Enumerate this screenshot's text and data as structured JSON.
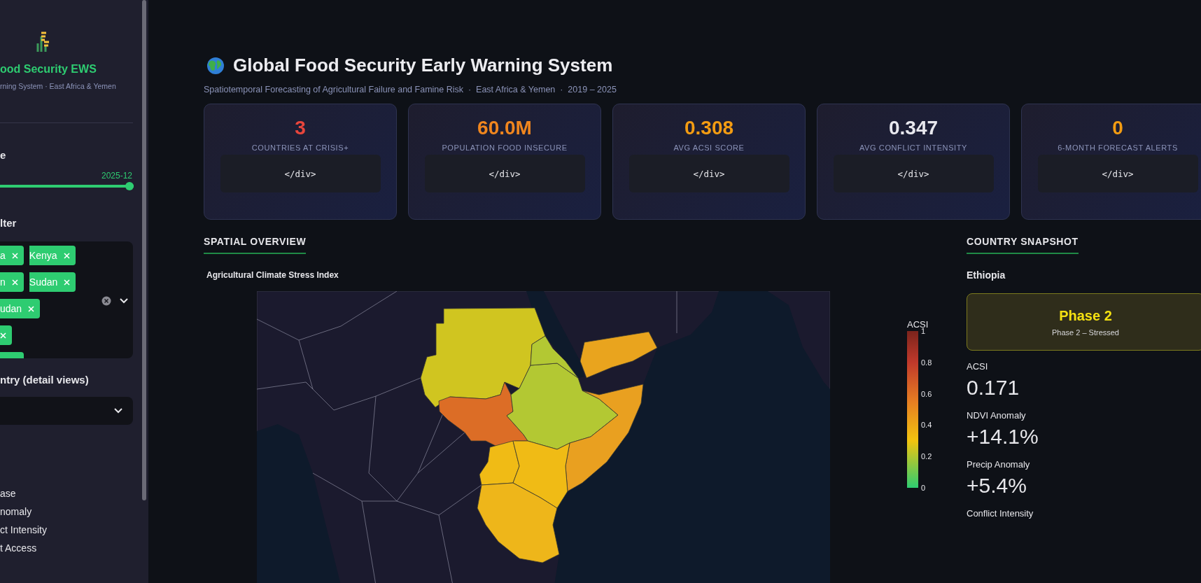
{
  "sidebar": {
    "title": "ood Security EWS",
    "subtitle": "rning System · East Africa & Yemen",
    "date_slider": {
      "label": "e",
      "value": "2025-12",
      "level": 1
    },
    "country_filter": {
      "label": "lter",
      "tag_rows": [
        {
          "tags": [
            {
              "kind": "chip",
              "label": "a"
            },
            {
              "kind": "chip",
              "label": "Kenya"
            }
          ]
        },
        {
          "tags": [
            {
              "kind": "chip",
              "label": "n"
            },
            {
              "kind": "chip",
              "label": "Sudan"
            }
          ]
        },
        {
          "tags": [
            {
              "kind": "chip",
              "label": "udan"
            }
          ]
        },
        {
          "tags": [
            {
              "kind": "icon"
            }
          ]
        },
        {
          "tags": [
            {
              "kind": "clipped"
            }
          ]
        }
      ]
    },
    "focus_country": {
      "label": "ntry (detail views)"
    },
    "map_layer": {
      "options": [
        {
          "label": "ase"
        },
        {
          "label": "nomaly"
        },
        {
          "label": "ct Intensity"
        },
        {
          "label": "t Access"
        }
      ]
    }
  },
  "header": {
    "title": "Global Food Security Early Warning System",
    "subtitle": "Spatiotemporal Forecasting of Agricultural Failure and Famine Risk  ·  East Africa & Yemen  ·  2019 – 2025"
  },
  "kpi_cards": [
    {
      "value": "3",
      "label": "COUNTRIES AT CRISIS+",
      "color": "#e8453c",
      "note": "</div>"
    },
    {
      "value": "60.0M",
      "label": "POPULATION FOOD INSECURE",
      "color": "#f0861e",
      "note": "</div>"
    },
    {
      "value": "0.308",
      "label": "AVG ACSI SCORE",
      "color": "#f39c12",
      "note": "</div>"
    },
    {
      "value": "0.347",
      "label": "AVG CONFLICT INTENSITY",
      "color": "#e8e8ee",
      "note": "</div>"
    },
    {
      "value": "0",
      "label": "6-MONTH FORECAST ALERTS",
      "color": "#f39c12",
      "note": "</div>"
    }
  ],
  "spatial_overview": {
    "heading": "SPATIAL OVERVIEW",
    "map_title": "Agricultural Climate Stress Index",
    "colorbar": {
      "title": "ACSI",
      "ticks": [
        "1",
        "0.8",
        "0.6",
        "0.4",
        "0.2",
        "0"
      ]
    }
  },
  "country_snapshot": {
    "heading": "COUNTRY SNAPSHOT",
    "country": "Ethiopia",
    "phase": {
      "kind": "stressed",
      "title": "Phase 2",
      "subtitle": "Phase 2 – Stressed"
    },
    "metrics": [
      {
        "label": "ACSI",
        "value": "0.171"
      },
      {
        "label": "NDVI Anomaly",
        "value": "+14.1%"
      },
      {
        "label": "Precip Anomaly",
        "value": "+5.4%"
      },
      {
        "label": "Conflict Intensity"
      }
    ]
  }
}
